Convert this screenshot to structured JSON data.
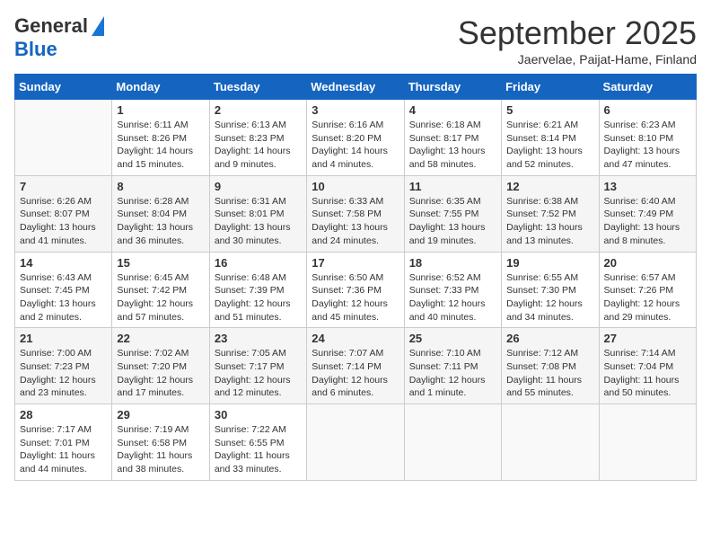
{
  "logo": {
    "general": "General",
    "blue": "Blue"
  },
  "header": {
    "title": "September 2025",
    "subtitle": "Jaervelae, Paijat-Hame, Finland"
  },
  "days_of_week": [
    "Sunday",
    "Monday",
    "Tuesday",
    "Wednesday",
    "Thursday",
    "Friday",
    "Saturday"
  ],
  "weeks": [
    [
      {
        "day": "",
        "lines": []
      },
      {
        "day": "1",
        "lines": [
          "Sunrise: 6:11 AM",
          "Sunset: 8:26 PM",
          "Daylight: 14 hours",
          "and 15 minutes."
        ]
      },
      {
        "day": "2",
        "lines": [
          "Sunrise: 6:13 AM",
          "Sunset: 8:23 PM",
          "Daylight: 14 hours",
          "and 9 minutes."
        ]
      },
      {
        "day": "3",
        "lines": [
          "Sunrise: 6:16 AM",
          "Sunset: 8:20 PM",
          "Daylight: 14 hours",
          "and 4 minutes."
        ]
      },
      {
        "day": "4",
        "lines": [
          "Sunrise: 6:18 AM",
          "Sunset: 8:17 PM",
          "Daylight: 13 hours",
          "and 58 minutes."
        ]
      },
      {
        "day": "5",
        "lines": [
          "Sunrise: 6:21 AM",
          "Sunset: 8:14 PM",
          "Daylight: 13 hours",
          "and 52 minutes."
        ]
      },
      {
        "day": "6",
        "lines": [
          "Sunrise: 6:23 AM",
          "Sunset: 8:10 PM",
          "Daylight: 13 hours",
          "and 47 minutes."
        ]
      }
    ],
    [
      {
        "day": "7",
        "lines": [
          "Sunrise: 6:26 AM",
          "Sunset: 8:07 PM",
          "Daylight: 13 hours",
          "and 41 minutes."
        ]
      },
      {
        "day": "8",
        "lines": [
          "Sunrise: 6:28 AM",
          "Sunset: 8:04 PM",
          "Daylight: 13 hours",
          "and 36 minutes."
        ]
      },
      {
        "day": "9",
        "lines": [
          "Sunrise: 6:31 AM",
          "Sunset: 8:01 PM",
          "Daylight: 13 hours",
          "and 30 minutes."
        ]
      },
      {
        "day": "10",
        "lines": [
          "Sunrise: 6:33 AM",
          "Sunset: 7:58 PM",
          "Daylight: 13 hours",
          "and 24 minutes."
        ]
      },
      {
        "day": "11",
        "lines": [
          "Sunrise: 6:35 AM",
          "Sunset: 7:55 PM",
          "Daylight: 13 hours",
          "and 19 minutes."
        ]
      },
      {
        "day": "12",
        "lines": [
          "Sunrise: 6:38 AM",
          "Sunset: 7:52 PM",
          "Daylight: 13 hours",
          "and 13 minutes."
        ]
      },
      {
        "day": "13",
        "lines": [
          "Sunrise: 6:40 AM",
          "Sunset: 7:49 PM",
          "Daylight: 13 hours",
          "and 8 minutes."
        ]
      }
    ],
    [
      {
        "day": "14",
        "lines": [
          "Sunrise: 6:43 AM",
          "Sunset: 7:45 PM",
          "Daylight: 13 hours",
          "and 2 minutes."
        ]
      },
      {
        "day": "15",
        "lines": [
          "Sunrise: 6:45 AM",
          "Sunset: 7:42 PM",
          "Daylight: 12 hours",
          "and 57 minutes."
        ]
      },
      {
        "day": "16",
        "lines": [
          "Sunrise: 6:48 AM",
          "Sunset: 7:39 PM",
          "Daylight: 12 hours",
          "and 51 minutes."
        ]
      },
      {
        "day": "17",
        "lines": [
          "Sunrise: 6:50 AM",
          "Sunset: 7:36 PM",
          "Daylight: 12 hours",
          "and 45 minutes."
        ]
      },
      {
        "day": "18",
        "lines": [
          "Sunrise: 6:52 AM",
          "Sunset: 7:33 PM",
          "Daylight: 12 hours",
          "and 40 minutes."
        ]
      },
      {
        "day": "19",
        "lines": [
          "Sunrise: 6:55 AM",
          "Sunset: 7:30 PM",
          "Daylight: 12 hours",
          "and 34 minutes."
        ]
      },
      {
        "day": "20",
        "lines": [
          "Sunrise: 6:57 AM",
          "Sunset: 7:26 PM",
          "Daylight: 12 hours",
          "and 29 minutes."
        ]
      }
    ],
    [
      {
        "day": "21",
        "lines": [
          "Sunrise: 7:00 AM",
          "Sunset: 7:23 PM",
          "Daylight: 12 hours",
          "and 23 minutes."
        ]
      },
      {
        "day": "22",
        "lines": [
          "Sunrise: 7:02 AM",
          "Sunset: 7:20 PM",
          "Daylight: 12 hours",
          "and 17 minutes."
        ]
      },
      {
        "day": "23",
        "lines": [
          "Sunrise: 7:05 AM",
          "Sunset: 7:17 PM",
          "Daylight: 12 hours",
          "and 12 minutes."
        ]
      },
      {
        "day": "24",
        "lines": [
          "Sunrise: 7:07 AM",
          "Sunset: 7:14 PM",
          "Daylight: 12 hours",
          "and 6 minutes."
        ]
      },
      {
        "day": "25",
        "lines": [
          "Sunrise: 7:10 AM",
          "Sunset: 7:11 PM",
          "Daylight: 12 hours",
          "and 1 minute."
        ]
      },
      {
        "day": "26",
        "lines": [
          "Sunrise: 7:12 AM",
          "Sunset: 7:08 PM",
          "Daylight: 11 hours",
          "and 55 minutes."
        ]
      },
      {
        "day": "27",
        "lines": [
          "Sunrise: 7:14 AM",
          "Sunset: 7:04 PM",
          "Daylight: 11 hours",
          "and 50 minutes."
        ]
      }
    ],
    [
      {
        "day": "28",
        "lines": [
          "Sunrise: 7:17 AM",
          "Sunset: 7:01 PM",
          "Daylight: 11 hours",
          "and 44 minutes."
        ]
      },
      {
        "day": "29",
        "lines": [
          "Sunrise: 7:19 AM",
          "Sunset: 6:58 PM",
          "Daylight: 11 hours",
          "and 38 minutes."
        ]
      },
      {
        "day": "30",
        "lines": [
          "Sunrise: 7:22 AM",
          "Sunset: 6:55 PM",
          "Daylight: 11 hours",
          "and 33 minutes."
        ]
      },
      {
        "day": "",
        "lines": []
      },
      {
        "day": "",
        "lines": []
      },
      {
        "day": "",
        "lines": []
      },
      {
        "day": "",
        "lines": []
      }
    ]
  ]
}
